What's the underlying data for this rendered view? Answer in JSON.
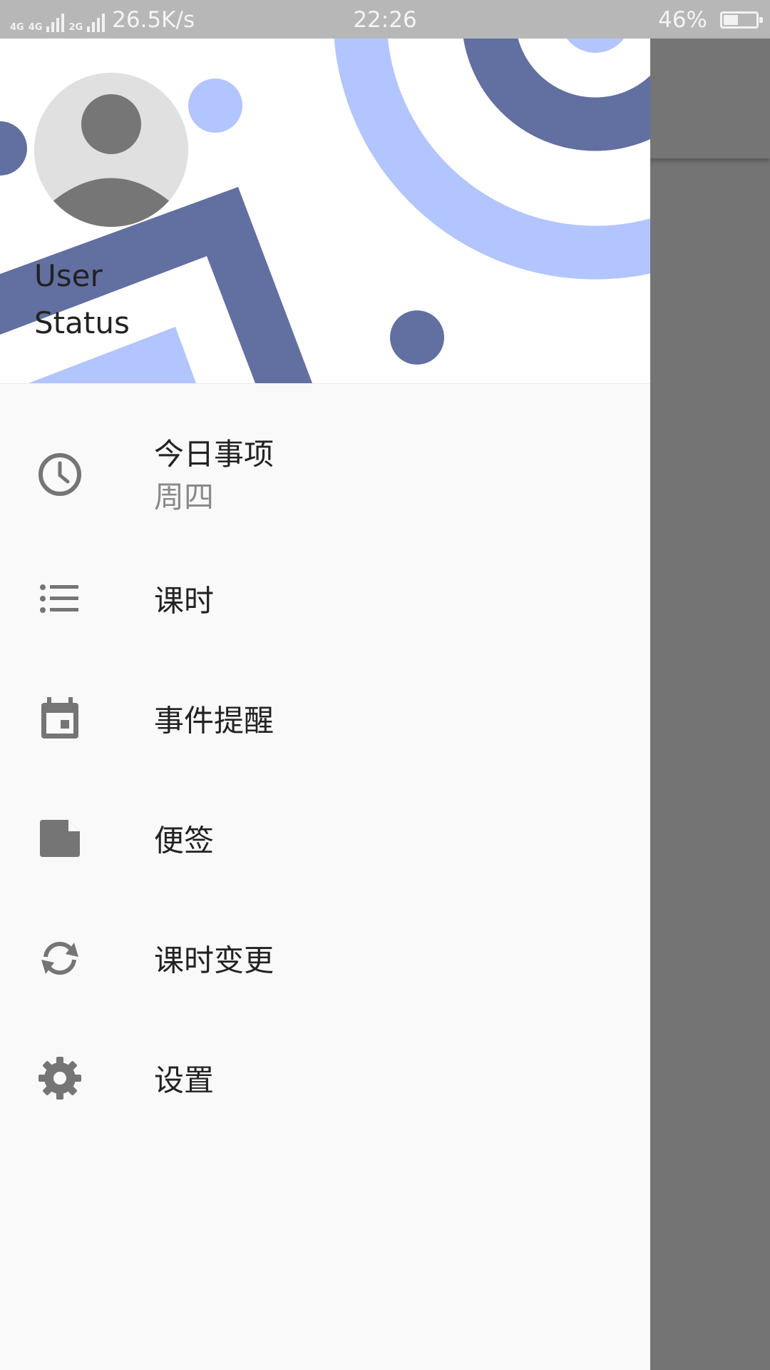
{
  "status_bar": {
    "network_labels": [
      "4G",
      "4G",
      "2G"
    ],
    "speed": "26.5K/s",
    "time": "22:26",
    "battery_percent": "46%",
    "battery_level": 0.46
  },
  "drawer": {
    "header": {
      "user": "User",
      "status": "Status",
      "colors": {
        "dark": "#626fa1",
        "light": "#b3c5fe"
      }
    },
    "items": [
      {
        "label": "今日事项",
        "sub": "周四",
        "icon": "clock-icon"
      },
      {
        "label": "课时",
        "icon": "list-icon"
      },
      {
        "label": "事件提醒",
        "icon": "calendar-icon"
      },
      {
        "label": "便签",
        "icon": "note-icon"
      },
      {
        "label": "课时变更",
        "icon": "sync-icon"
      },
      {
        "label": "设置",
        "icon": "gear-icon"
      }
    ]
  }
}
